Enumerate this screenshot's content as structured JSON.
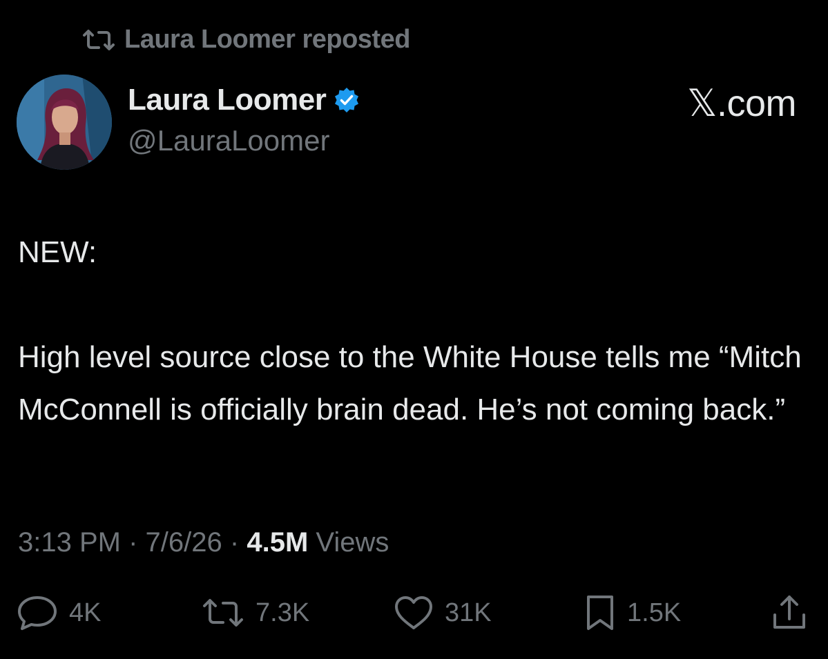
{
  "repost": {
    "label": "Laura Loomer reposted",
    "icon": "repost-icon"
  },
  "author": {
    "display_name": "Laura Loomer",
    "handle": "@LauraLoomer",
    "verified": true,
    "badge_color": "#1d9bf0"
  },
  "source": {
    "logo_text": "𝕏.com"
  },
  "tweet": {
    "paragraphs": [
      "NEW:",
      "High level source close to the White House tells me “Mitch McConnell is officially brain dead. He’s not coming back.”"
    ]
  },
  "meta": {
    "time": "3:13 PM",
    "separator": "·",
    "date": "7/6/26",
    "views_count": "4.5M",
    "views_label": "Views"
  },
  "actions": {
    "reply": {
      "icon": "reply-icon",
      "count": "4K"
    },
    "repost": {
      "icon": "repost-icon",
      "count": "7.3K"
    },
    "like": {
      "icon": "heart-icon",
      "count": "31K"
    },
    "bookmark": {
      "icon": "bookmark-icon",
      "count": "1.5K"
    },
    "share": {
      "icon": "share-icon"
    }
  },
  "colors": {
    "background": "#000000",
    "primary_text": "#e7e9ea",
    "secondary_text": "#71767b",
    "verified_blue": "#1d9bf0"
  }
}
